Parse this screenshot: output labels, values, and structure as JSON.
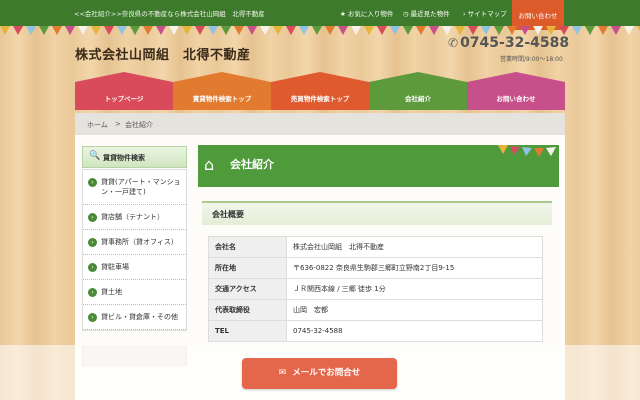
{
  "topbar": {
    "tagline": "<<会社紹介>>奈良県の不動産なら株式会社山岡組　北得不動産",
    "favorites": "お気に入り物件",
    "recent": "最近見た物件",
    "sitemap": "サイトマップ",
    "contact": "お問い合わせ",
    "favorites_icon": "star-icon",
    "recent_icon": "clock-icon",
    "sitemap_icon": "chevron-right-icon"
  },
  "header": {
    "title": "株式会社山岡組　北得不動産",
    "phone": "0745-32-4588",
    "hours": "営業時間/9:00～18:00",
    "phone_icon": "phone-icon"
  },
  "nav": {
    "items": [
      {
        "label": "トップページ",
        "color": "#d94a5a"
      },
      {
        "label": "賃貸物件検索トップ",
        "color": "#e27b30"
      },
      {
        "label": "売買物件検索トップ",
        "color": "#e05a30"
      },
      {
        "label": "会社紹介",
        "color": "#5c9a3c"
      },
      {
        "label": "お問い合わせ",
        "color": "#c8508a"
      }
    ]
  },
  "breadcrumb": {
    "home": "ホーム",
    "sep": ">",
    "current": "会社紹介"
  },
  "sidebar": {
    "heading": "賃貸物件検索",
    "heading_icon": "search-icon",
    "items": [
      {
        "label": "貸貸(アパート・マンション・一戸建て)"
      },
      {
        "label": "貸店舗（テナント）"
      },
      {
        "label": "貸事務所（貸オフィス）"
      },
      {
        "label": "貸駐車場"
      },
      {
        "label": "貸土地"
      },
      {
        "label": "貸ビル・貸倉庫・その他"
      }
    ]
  },
  "content": {
    "banner_title": "会社紹介",
    "banner_icon": "house-icon",
    "section_title": "会社概要",
    "rows": [
      {
        "key": "会社名",
        "value": "株式会社山岡組　北得不動産"
      },
      {
        "key": "所在地",
        "value": "〒636-0822 奈良県生駒郡三郷町立野南2丁目9-15"
      },
      {
        "key": "交通アクセス",
        "value": "ＪＲ関西本線 / 三郷 徒歩 1分"
      },
      {
        "key": "代表取締役",
        "value": "山岡　宏都"
      },
      {
        "key": "TEL",
        "value": "0745-32-4588"
      }
    ]
  },
  "cta": {
    "mail_label": "メールでお問合せ",
    "mail_icon": "envelope-icon"
  },
  "colors": {
    "topbar": "#3d7a2b",
    "accent_orange": "#dd5a2b",
    "banner_green": "#4f9a3a",
    "cta": "#e5674b"
  }
}
